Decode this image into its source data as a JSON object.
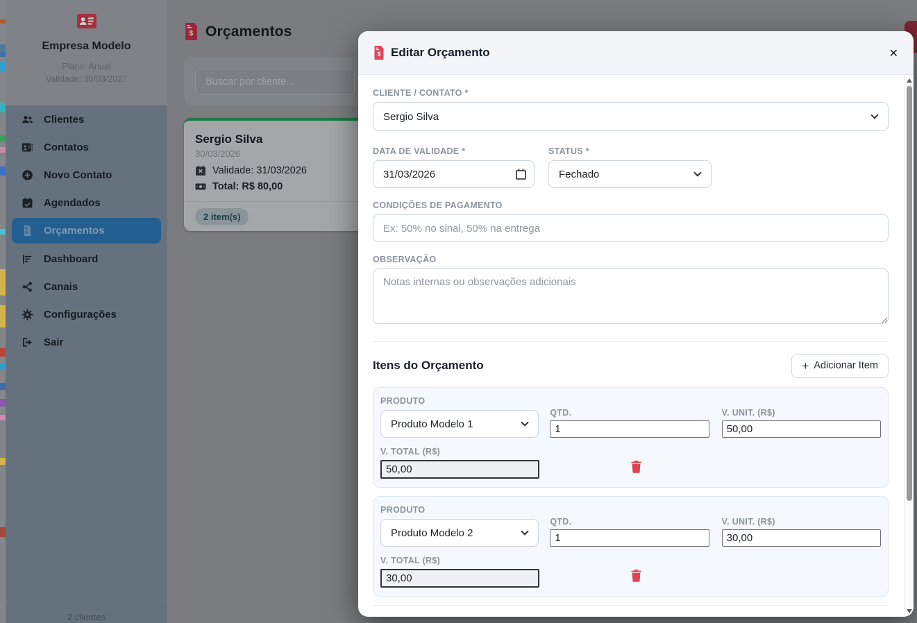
{
  "colors": {
    "brand_red": "#9e2b3a",
    "modal_brand_red": "#e0455a",
    "accent_blue": "#235e91",
    "success_green": "#1e7a46",
    "danger_red": "#e04450"
  },
  "sidebar": {
    "company": "Empresa Modelo",
    "plan": "Plano: Anual",
    "validity": "Validade: 30/03/2027",
    "items": [
      {
        "label": "Clientes",
        "icon": "users-icon"
      },
      {
        "label": "Contatos",
        "icon": "contact-card-icon"
      },
      {
        "label": "Novo Contato",
        "icon": "plus-circle-icon"
      },
      {
        "label": "Agendados",
        "icon": "calendar-check-icon"
      },
      {
        "label": "Orçamentos",
        "icon": "invoice-icon",
        "active": true
      },
      {
        "label": "Dashboard",
        "icon": "chart-icon"
      },
      {
        "label": "Canais",
        "icon": "share-icon"
      },
      {
        "label": "Configurações",
        "icon": "gear-icon"
      },
      {
        "label": "Sair",
        "icon": "logout-icon"
      }
    ],
    "footer": "2 clientes"
  },
  "main": {
    "title": "Orçamentos",
    "search_placeholder": "Buscar por cliente...",
    "card": {
      "name": "Sergio Silva",
      "date": "30/03/2026",
      "validity": "Validade: 31/03/2026",
      "total": "Total: R$ 80,00",
      "badge": "2 item(s)"
    }
  },
  "modal": {
    "title": "Editar Orçamento",
    "close_glyph": "✕",
    "fields": {
      "cliente": {
        "label": "CLIENTE / CONTATO *",
        "value": "Sergio Silva"
      },
      "validade": {
        "label": "DATA DE VALIDADE *",
        "value": "31/03/2026"
      },
      "status": {
        "label": "STATUS *",
        "value": "Fechado"
      },
      "condicoes": {
        "label": "CONDIÇÕES DE PAGAMENTO",
        "placeholder": "Ex: 50% no sinal, 50% na entrega"
      },
      "observacao": {
        "label": "OBSERVAÇÃO",
        "placeholder": "Notas internas ou observações adicionais"
      }
    },
    "items_section": {
      "heading": "Itens do Orçamento",
      "add_button_plus": "+",
      "add_button_label": "Adicionar Item",
      "labels": {
        "produto": "PRODUTO",
        "qtd": "QTD.",
        "vunit": "V. UNIT. (R$)",
        "vtotal": "V. TOTAL (R$)"
      },
      "items": [
        {
          "produto": "Produto Modelo 1",
          "qtd": "1",
          "vunit": "50,00",
          "vtotal": "50,00"
        },
        {
          "produto": "Produto Modelo 2",
          "qtd": "1",
          "vunit": "30,00",
          "vtotal": "30,00"
        }
      ]
    }
  }
}
